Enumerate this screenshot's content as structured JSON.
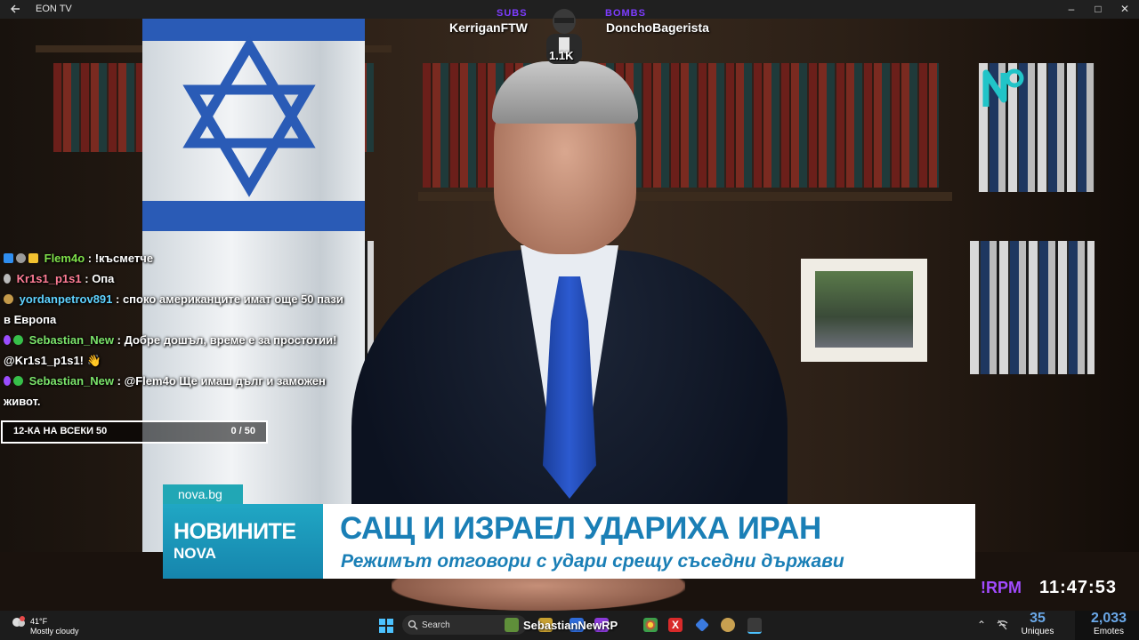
{
  "window": {
    "title": "EON TV"
  },
  "streamers": {
    "subs_label": "SUBS",
    "bombs_label": "BOMBS",
    "subs_user": "KerriganFTW",
    "bombs_user": "DonchoBagerista",
    "count": "1.1K"
  },
  "chat": [
    {
      "user": "Flem4o",
      "message": ": !късметче"
    },
    {
      "user": "Kr1s1_p1s1",
      "message": ": Опа"
    },
    {
      "user": "yordanpetrov891",
      "message": ": споко американците имат още 50 пази в Европа"
    },
    {
      "user": "Sebastian_New",
      "message": ": Добре дошъл, време е за простотии! @Kr1s1_p1s1! 👋"
    },
    {
      "user": "Sebastian_New",
      "message": ": @Flem4o Ще имаш дълг и заможен живот."
    }
  ],
  "goal": {
    "label": "12-КА НА ВСЕКИ 50",
    "progress": "0 / 50"
  },
  "news": {
    "site": "nova.bg",
    "show_line1": "НОВИНИТЕ",
    "show_line2": "NOVA",
    "headline": "САЩ И ИЗРАЕЛ УДАРИХА ИРАН",
    "subheadline": "Режимът отговори с удари срещу съседни държави"
  },
  "overlay": {
    "rpm": "!RPM",
    "clock": "11:47:53",
    "uniques_value": "35",
    "uniques_label": "Uniques",
    "emotes_value": "2,033",
    "emotes_label": "Emotes",
    "streamer_name": "SebastianNewRP"
  },
  "taskbar": {
    "temperature": "41°F",
    "condition": "Mostly cloudy",
    "search_placeholder": "Search"
  },
  "colors": {
    "accent": "#7d3cff",
    "news_blue": "#1a7fb6",
    "news_teal": "#21a7b5"
  }
}
